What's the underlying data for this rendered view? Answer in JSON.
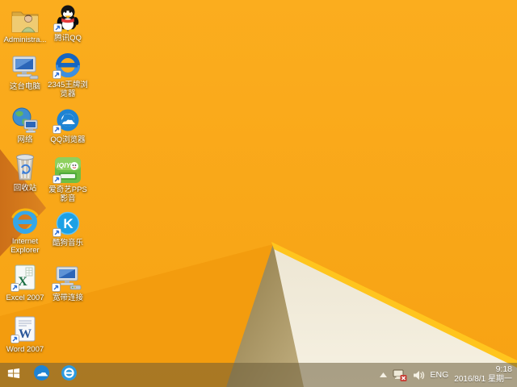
{
  "wallpaper": {
    "base_color": "#FAAA1B",
    "lower_left_color": "#F29B0D",
    "dark_fold_color": "#D2771D",
    "tan_facet_color": "#A8925F",
    "white_facet_color": "#F2ECDC",
    "bright_edge_color": "#FFC51E"
  },
  "desktop": {
    "icons": [
      {
        "id": "administrator",
        "label": "Administra...",
        "icon": "user-folder-icon",
        "shortcut": false
      },
      {
        "id": "tencent-qq",
        "label": "腾讯QQ",
        "icon": "qq-penguin-icon",
        "shortcut": true
      },
      {
        "id": "this-pc",
        "label": "这台电脑",
        "icon": "computer-icon",
        "shortcut": false
      },
      {
        "id": "2345-browser",
        "label": "2345王牌浏览器",
        "icon": "blue-e-browser-icon",
        "shortcut": true
      },
      {
        "id": "network",
        "label": "网络",
        "icon": "network-globe-icon",
        "shortcut": false
      },
      {
        "id": "qq-browser",
        "label": "QQ浏览器",
        "icon": "qq-browser-cloud-icon",
        "shortcut": true
      },
      {
        "id": "recycle-bin",
        "label": "回收站",
        "icon": "recycle-bin-icon",
        "shortcut": false
      },
      {
        "id": "iqiyi-pps",
        "label": "爱奇艺PPS影音",
        "icon": "iqiyi-icon",
        "shortcut": true
      },
      {
        "id": "internet-explorer",
        "label": "Internet Explorer",
        "icon": "ie-icon",
        "shortcut": false
      },
      {
        "id": "kugou-music",
        "label": "酷狗音乐",
        "icon": "kugou-icon",
        "shortcut": true
      },
      {
        "id": "excel-2007",
        "label": "Excel 2007",
        "icon": "excel-icon",
        "shortcut": true
      },
      {
        "id": "broadband",
        "label": "宽带连接",
        "icon": "broadband-icon",
        "shortcut": true
      },
      {
        "id": "word-2007",
        "label": "Word 2007",
        "icon": "word-icon",
        "shortcut": true
      }
    ]
  },
  "icon_glyphs": {
    "iqiyi": "iQIYI",
    "kugou": "K",
    "excel": "X",
    "word": "W"
  },
  "taskbar": {
    "pinned": [
      {
        "id": "start",
        "icon": "windows-start-icon"
      },
      {
        "id": "qq-browser",
        "icon": "qq-browser-cloud-icon"
      },
      {
        "id": "internet-explorer",
        "icon": "ie-circle-icon"
      }
    ],
    "tray": {
      "hidden_icons": "show-hidden-icons",
      "network_status": "disconnected",
      "language": "ENG",
      "time": "9:18",
      "date": "2016/8/1 星期一"
    }
  }
}
